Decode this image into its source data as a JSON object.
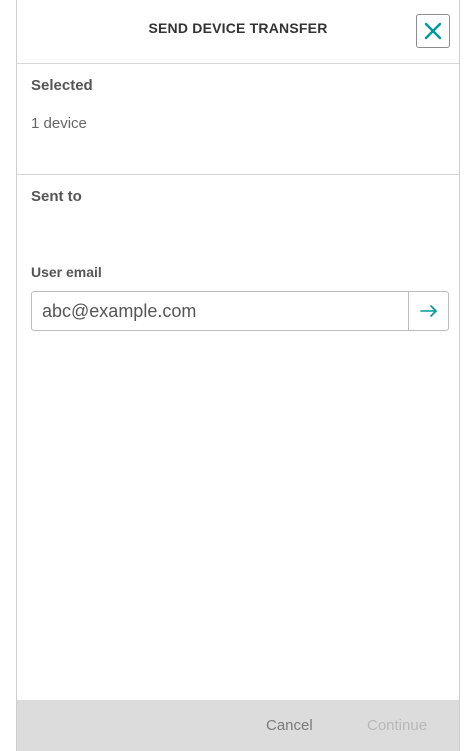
{
  "dialog": {
    "title": "SEND DEVICE TRANSFER",
    "close_icon": "close-icon",
    "accent_color": "#009a9a"
  },
  "selected": {
    "heading": "Selected",
    "value": "1 device"
  },
  "sent_to": {
    "heading": "Sent to",
    "email_label": "User email",
    "email_placeholder": "abc@example.com",
    "submit_icon": "arrow-right-icon"
  },
  "footer": {
    "cancel_label": "Cancel",
    "continue_label": "Continue"
  }
}
